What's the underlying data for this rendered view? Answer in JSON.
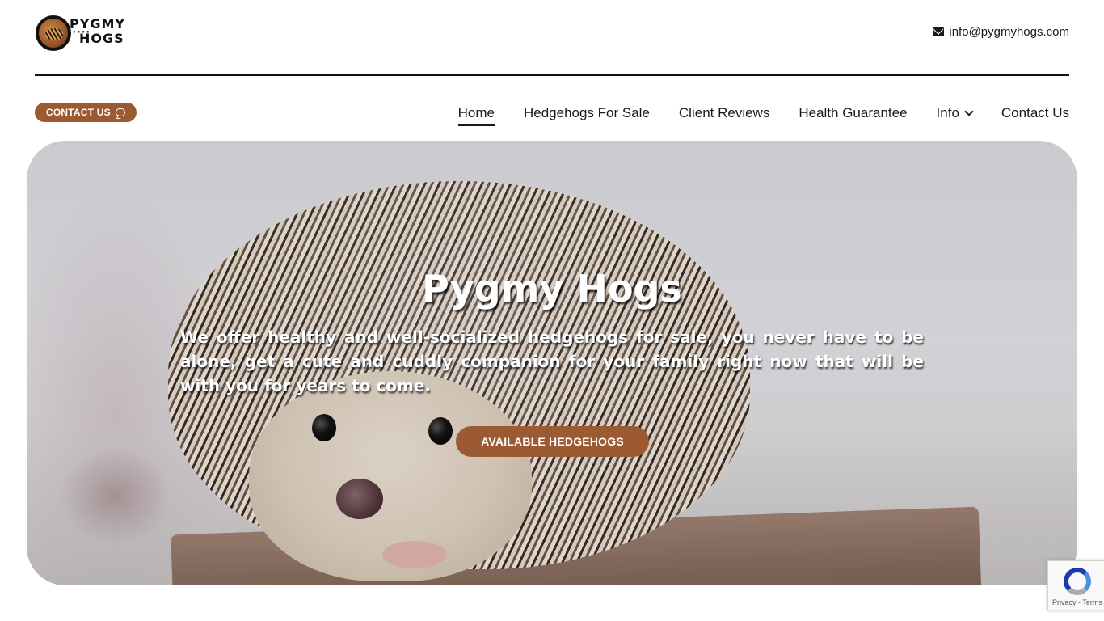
{
  "header": {
    "logo_line1": "PYGMY",
    "logo_line2": "HOGS",
    "email": "info@pygmyhogs.com"
  },
  "contact_pill": {
    "label": "CONTACT US"
  },
  "nav": {
    "items": [
      {
        "label": "Home",
        "active": true
      },
      {
        "label": "Hedgehogs For Sale"
      },
      {
        "label": "Client Reviews"
      },
      {
        "label": "Health Guarantee"
      },
      {
        "label": "Info",
        "has_dropdown": true
      },
      {
        "label": "Contact Us"
      }
    ]
  },
  "hero": {
    "title": "Pygmy Hogs",
    "text": "We offer healthy and well-socialized hedgehogs for sale, you never have to be alone, get a cute and cuddly companion for your family right now that will be with you for years to come.",
    "button_label": "AVAILABLE HEDGEHOGS"
  },
  "recaptcha": {
    "links": "Privacy - Terms"
  },
  "colors": {
    "accent": "#9c5a33",
    "text": "#1a1a1a",
    "rule": "#111111"
  },
  "icons": {
    "email": "envelope-icon",
    "contact": "chat-icon",
    "info_dropdown": "chevron-down-icon",
    "captcha": "recaptcha-icon"
  }
}
